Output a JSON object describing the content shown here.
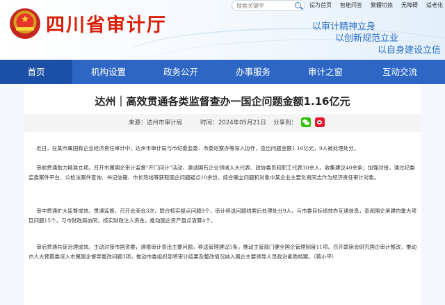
{
  "header": {
    "site_title": "四川省审计厅",
    "search_placeholder": "搜索关键字",
    "top_links": [
      "设为首页",
      "智能问答",
      "繁體切換",
      "无障碍",
      "适老化"
    ],
    "slogans": [
      "以审计精神立身",
      "以创新规范立业",
      "以自身建设立信"
    ]
  },
  "nav": {
    "items": [
      "首页",
      "机构设置",
      "政务公开",
      "办事服务",
      "审计之窗",
      "互动交流"
    ],
    "active_index": 0
  },
  "article": {
    "title": "达州｜高效贯通各类监督查办一国企问题金额1.16亿元",
    "source_label": "来源：",
    "source": "达州市审计局",
    "date_label": "时间：",
    "date": "2024年05月21日",
    "share_label": "分享到：",
    "paragraphs": [
      "近日，在某市属国有企业经济责任审计中，达州市审计局与市纪委监委、市委巡察办等深入协作，查出问题金额1.16亿元，9人被处理处分。",
      "审前贯通助力精准立项。召开市属国企审计监督“开门问计”活动，邀请国有企业领域人大代表、政协委员和职工代表30余人，收集建议40余条；加强对接，通过纪委监委案件平台、公检法案件查询、书记信箱、市长热线等获取国企问题疑点10余份，综合确立问题和对象中某企业主要负责同志作为经济责任审计对象。",
      "审中贯通扩大监督成效。贯通监督，召开会商会3次，联合核实疑点问题8个，审计移送问题线索后处理处分9人，与市委目标绩效办互通信息，查阅国企承建的重大项目问题15个，与市财政局协同，核实财政注入资金，推动国企资产盘点清算4个。",
      "审后贯通共促治理成效。主动对接市国资委，通报审计查出主要问题，移送管理建议5条，推动主管部门健全国企管理制度11项。召开联席会研究国企审计整改，推动市人大预算委深入市属国企督导整改问题3项，推动市委组织部将审计结果及整改情况纳入国企主要领导人员政治素质档案。（蒋小平）"
    ]
  },
  "colors": {
    "title_red": "#d81e06",
    "nav_blue": "#2e66c6",
    "nav_active": "#1c4fa6",
    "slogan_blue": "#2a6fc9"
  },
  "icons": [
    "national-emblem-icon",
    "search-icon",
    "wechat-icon",
    "weibo-icon"
  ]
}
